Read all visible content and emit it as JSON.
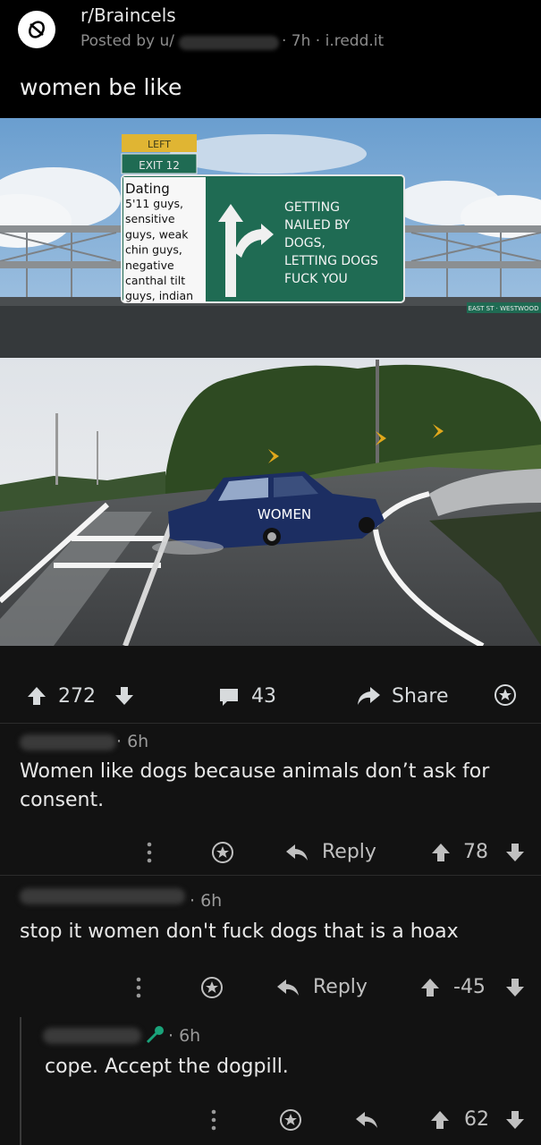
{
  "post": {
    "subreddit": "r/Braincels",
    "posted_by": "Posted by u/",
    "meta": "· 7h · i.redd.it",
    "title": "women be like"
  },
  "meme": {
    "sign_top_label": "LEFT",
    "sign_exit_label": "EXIT 12",
    "sign_left_text": [
      "Dating",
      "5'11 guys,",
      "sensitive",
      "guys, weak",
      "chin guys,",
      "negative",
      "canthal tilt",
      "guys, indian"
    ],
    "sign_right_text": [
      "GETTING",
      "NAILED BY",
      "DOGS,",
      "LETTING DOGS",
      "FUCK YOU"
    ],
    "small_sign_text": "EAST ST · WESTWOOD",
    "car_label": "WOMEN"
  },
  "actions": {
    "upvotes": "272",
    "comments": "43",
    "share_label": "Share"
  },
  "comments": [
    {
      "time": "· 6h",
      "text": "Women like dogs because animals don’t ask for consent.",
      "reply_label": "Reply",
      "score": "78"
    },
    {
      "time": "· 6h",
      "text": "stop it women don't fuck dogs that is a hoax",
      "reply_label": "Reply",
      "score": "-45"
    },
    {
      "time": "· 6h",
      "text": "cope. Accept the dogpill.",
      "score": "62"
    }
  ],
  "colors": {
    "background": "#000000",
    "comment_bg": "#121212",
    "sign_green": "#1f6b53",
    "sign_yellow": "#e0b533",
    "car_blue": "#1c2e62",
    "flair_green": "#1aa37a"
  },
  "icons": [
    "subreddit-icon",
    "upvote-icon",
    "downvote-icon",
    "comment-icon",
    "share-icon",
    "award-icon",
    "reply-icon",
    "more-icon",
    "flair-icon"
  ]
}
